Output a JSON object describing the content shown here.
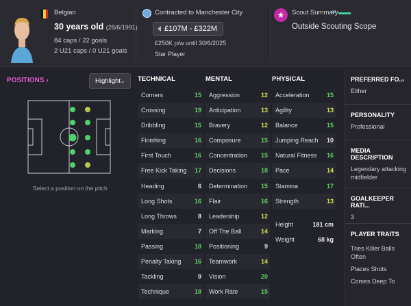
{
  "header": {
    "nationality": "Belgian",
    "age": "30 years old",
    "dob": "(28/6/1991)",
    "caps": "84 caps / 22 goals",
    "u21": "2 U21 caps / 0 U21 goals",
    "contract": "Contracted to Manchester City",
    "value": "£107M - £322M",
    "wage": "£250K p/w until 30/6/2025",
    "status": "Star Player",
    "scout_title": "Scout Summary",
    "scout_desc": "Outside Scouting Scope",
    "colors": {
      "accent": "#e35bd0",
      "club": "#6cabdd",
      "scout": "#c22aa8"
    }
  },
  "positions": {
    "title": "POSITIONS",
    "title_icon": "chevron-right-icon",
    "highlight_label": "Highlight",
    "hint": "Select a position on the pitch"
  },
  "attributes": {
    "technical": {
      "title": "TECHNICAL",
      "items": [
        {
          "name": "Corners",
          "value": "15",
          "color": "green"
        },
        {
          "name": "Crossing",
          "value": "19",
          "color": "green"
        },
        {
          "name": "Dribbling",
          "value": "15",
          "color": "green"
        },
        {
          "name": "Finishing",
          "value": "16",
          "color": "green"
        },
        {
          "name": "First Touch",
          "value": "16",
          "color": "green"
        },
        {
          "name": "Free Kick Taking",
          "value": "17",
          "color": "green"
        },
        {
          "name": "Heading",
          "value": "6",
          "color": "white"
        },
        {
          "name": "Long Shots",
          "value": "16",
          "color": "green"
        },
        {
          "name": "Long Throws",
          "value": "8",
          "color": "white"
        },
        {
          "name": "Marking",
          "value": "7",
          "color": "white"
        },
        {
          "name": "Passing",
          "value": "18",
          "color": "green"
        },
        {
          "name": "Penalty Taking",
          "value": "16",
          "color": "green"
        },
        {
          "name": "Tackling",
          "value": "9",
          "color": "white"
        },
        {
          "name": "Technique",
          "value": "18",
          "color": "green"
        }
      ]
    },
    "mental": {
      "title": "MENTAL",
      "items": [
        {
          "name": "Aggression",
          "value": "12",
          "color": "yellow"
        },
        {
          "name": "Anticipation",
          "value": "13",
          "color": "yellow"
        },
        {
          "name": "Bravery",
          "value": "12",
          "color": "yellow"
        },
        {
          "name": "Composure",
          "value": "15",
          "color": "green"
        },
        {
          "name": "Concentration",
          "value": "15",
          "color": "green"
        },
        {
          "name": "Decisions",
          "value": "18",
          "color": "green"
        },
        {
          "name": "Determination",
          "value": "15",
          "color": "green"
        },
        {
          "name": "Flair",
          "value": "16",
          "color": "green"
        },
        {
          "name": "Leadership",
          "value": "12",
          "color": "yellow"
        },
        {
          "name": "Off The Ball",
          "value": "14",
          "color": "yellow"
        },
        {
          "name": "Positioning",
          "value": "9",
          "color": "white"
        },
        {
          "name": "Teamwork",
          "value": "14",
          "color": "yellow"
        },
        {
          "name": "Vision",
          "value": "20",
          "color": "green"
        },
        {
          "name": "Work Rate",
          "value": "15",
          "color": "green"
        }
      ]
    },
    "physical": {
      "title": "PHYSICAL",
      "items": [
        {
          "name": "Acceleration",
          "value": "15",
          "color": "green"
        },
        {
          "name": "Agility",
          "value": "13",
          "color": "yellow"
        },
        {
          "name": "Balance",
          "value": "15",
          "color": "green"
        },
        {
          "name": "Jumping Reach",
          "value": "10",
          "color": "white"
        },
        {
          "name": "Natural Fitness",
          "value": "16",
          "color": "green"
        },
        {
          "name": "Pace",
          "value": "14",
          "color": "yellow"
        },
        {
          "name": "Stamina",
          "value": "17",
          "color": "green"
        },
        {
          "name": "Strength",
          "value": "13",
          "color": "yellow"
        }
      ],
      "height_label": "Height",
      "height": "181 cm",
      "weight_label": "Weight",
      "weight": "68 kg"
    }
  },
  "right_panel": {
    "preferred_foot_title": "PREFERRED FO...",
    "preferred_foot": "Either",
    "personality_title": "PERSONALITY",
    "personality": "Professional",
    "media_title": "MEDIA DESCRIPTION",
    "media": "Legendary attacking midfielder",
    "gk_title": "GOALKEEPER RATI...",
    "gk": "3",
    "traits_title": "PLAYER TRAITS",
    "traits": [
      "Tries Killer Balls Often",
      "Places Shots",
      "Comes Deep To"
    ]
  }
}
